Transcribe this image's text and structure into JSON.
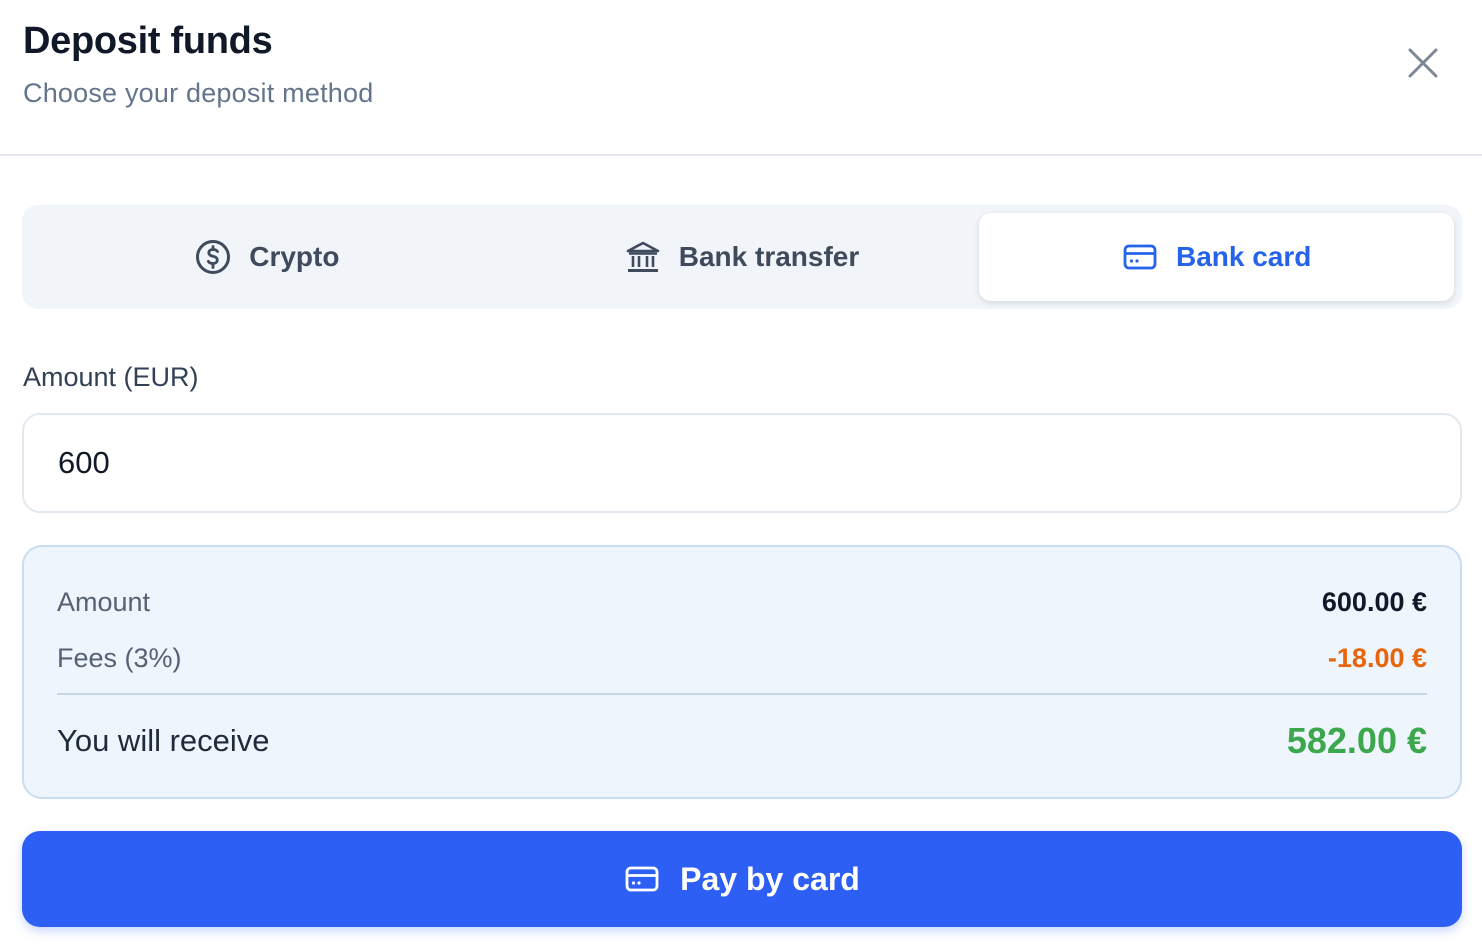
{
  "header": {
    "title": "Deposit funds",
    "subtitle": "Choose your deposit method"
  },
  "tabs": [
    {
      "label": "Crypto",
      "icon": "dollar-circle-icon",
      "active": false
    },
    {
      "label": "Bank transfer",
      "icon": "bank-icon",
      "active": false
    },
    {
      "label": "Bank card",
      "icon": "credit-card-icon",
      "active": true
    }
  ],
  "amount": {
    "label": "Amount (EUR)",
    "value": "600"
  },
  "summary": {
    "amount_label": "Amount",
    "amount_value": "600.00 €",
    "fees_label": "Fees (3%)",
    "fees_value": "-18.00 €",
    "receive_label": "You will receive",
    "receive_value": "582.00 €"
  },
  "pay_button": {
    "label": "Pay by card",
    "icon": "credit-card-icon"
  },
  "colors": {
    "accent": "#2563eb",
    "button": "#2d5ff5",
    "fees": "#e8650c",
    "receive": "#3da74d"
  }
}
